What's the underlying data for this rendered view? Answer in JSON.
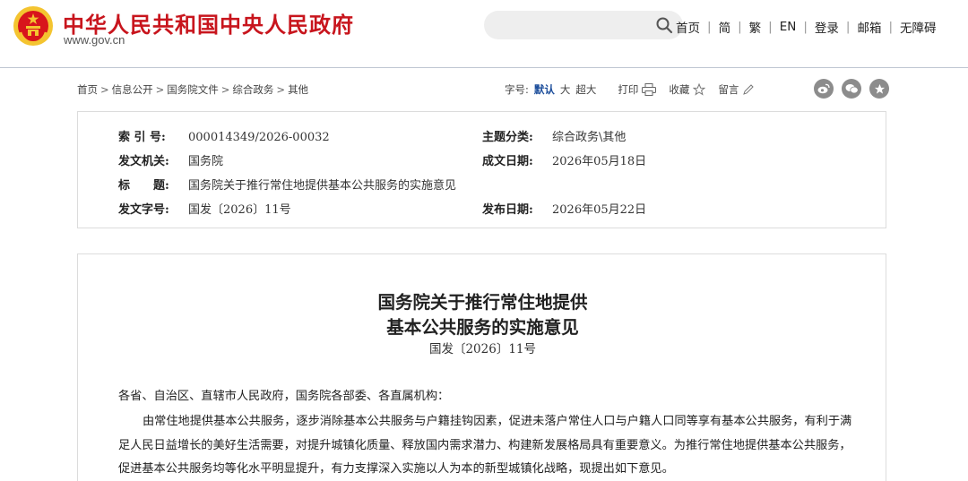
{
  "header": {
    "site_title": "中华人民共和国中央人民政府",
    "site_domain": "www.gov.cn",
    "search_placeholder": "",
    "nav": [
      "首页",
      "简",
      "繁",
      "EN",
      "登录",
      "邮箱",
      "无障碍"
    ]
  },
  "breadcrumb": [
    "首页",
    "信息公开",
    "国务院文件",
    "综合政务",
    "其他"
  ],
  "tools": {
    "font_size_label": "字号:",
    "font_default": "默认",
    "font_large": "大",
    "font_xlarge": "超大",
    "print_label": "打印",
    "favorite_label": "收藏",
    "comment_label": "留言"
  },
  "share": [
    "weibo-icon",
    "wechat-icon",
    "qzone-icon"
  ],
  "info": {
    "index_label": "索 引 号:",
    "index_value": "000014349/2026-00032",
    "category_label": "主题分类:",
    "category_value": "综合政务\\其他",
    "issuer_label": "发文机关:",
    "issuer_value": "国务院",
    "written_label": "成文日期:",
    "written_value": "2026年05月18日",
    "title_label": "标　　题:",
    "title_value": "国务院关于推行常住地提供基本公共服务的实施意见",
    "docno_label": "发文字号:",
    "docno_value": "国发〔2026〕11号",
    "published_label": "发布日期:",
    "published_value": "2026年05月22日"
  },
  "article": {
    "title_line1": "国务院关于推行常住地提供",
    "title_line2": "基本公共服务的实施意见",
    "doc_no": "国发〔2026〕11号",
    "salutation": "各省、自治区、直辖市人民政府，国务院各部委、各直属机构：",
    "body": "由常住地提供基本公共服务，逐步消除基本公共服务与户籍挂钩因素，促进未落户常住人口与户籍人口同等享有基本公共服务，有利于满足人民日益增长的美好生活需要，对提升城镇化质量、释放国内需求潜力、构建新发展格局具有重要意义。为推行常住地提供基本公共服务，促进基本公共服务均等化水平明显提升，有力支撑深入实施以人为本的新型城镇化战略，现提出如下意见。"
  },
  "colors": {
    "brand_red": "#c8151d",
    "link_blue": "#1a4c9a",
    "emblem_gold": "#f4c430"
  }
}
